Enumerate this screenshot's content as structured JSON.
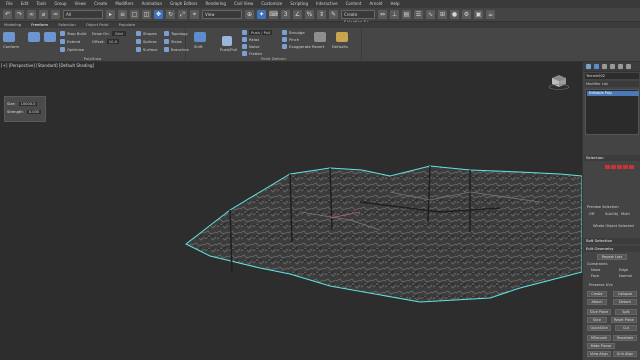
{
  "menubar": {
    "items": [
      "File",
      "Edit",
      "Tools",
      "Group",
      "Views",
      "Create",
      "Modifiers",
      "Animation",
      "Graph Editors",
      "Rendering",
      "Civil View",
      "Customize",
      "Scripting",
      "Interactive",
      "Content",
      "Arnold",
      "Help"
    ]
  },
  "toolbar": {
    "selection_filter": "All",
    "view": "View",
    "workspace": "Create Selection Se"
  },
  "tabs": {
    "items": [
      "Modeling",
      "Freeform",
      "Selection",
      "Object Paint",
      "Populate"
    ],
    "active_index": 1
  },
  "ribbon": {
    "polydraw": {
      "label": "PolyDraw",
      "conform": "Conform",
      "step_build": "Step Build",
      "extend": "Extend",
      "optimize": "Optimize",
      "draw_on": "Draw On:",
      "draw_on_value": "Grid",
      "offset_label": "Offset:",
      "offset_value": "10.0",
      "shapes": "Shapes",
      "splines": "Splines",
      "surface": "Surface",
      "topology": "Topology",
      "strips": "Strips",
      "branches": "Branches"
    },
    "paint_deform": {
      "label": "Paint Deform",
      "shift": "Shift",
      "push_pull": "Push/Pull",
      "mode": "Push / Pull",
      "relax": "Relax",
      "noise": "Noise",
      "flatten": "Flatten",
      "smudge": "Smudge",
      "pinch": "Pinch",
      "exaggerate": "Exaggerate",
      "revert": "Revert",
      "defaults": "Defaults"
    }
  },
  "viewport": {
    "label": "[+] [Perspective] [Standard] [Default Shading]",
    "input_panel": {
      "size_label": "Size:",
      "size_value": "10000.0",
      "strength_label": "Strength:",
      "strength_value": "0.035"
    }
  },
  "command_panel": {
    "object_name": "Terrain002",
    "modifier_list_label": "Modifier List",
    "stack_item": "Editable Poly",
    "selection_header": "Selection",
    "preview_selection": "Preview Selection",
    "off_label": "Off",
    "subobj_label": "SubObj",
    "multi_label": "Multi",
    "whole_object": "Whole Object Selected",
    "soft_selection_header": "Soft Selection",
    "edit_geometry_header": "Edit Geometry",
    "repeat_last": "Repeat Last",
    "constraints_label": "Constraints",
    "none_label": "None",
    "edge_label": "Edge",
    "face_label": "Face",
    "normal_label": "Normal",
    "preserve_uvs": "Preserve UVs",
    "create_label": "Create",
    "collapse_label": "Collapse",
    "attach_label": "Attach",
    "detach_label": "Detach",
    "slice_plane": "Slice Plane",
    "split_label": "Split",
    "slice_label": "Slice",
    "reset_plane": "Reset Plane",
    "quickslice": "QuickSlice",
    "cut_label": "Cut",
    "meshsmooth": "MSmooth",
    "tessellate": "Tessellate",
    "make_planar": "Make Planar",
    "view_align": "View Align",
    "grid_align": "Grid Align"
  }
}
